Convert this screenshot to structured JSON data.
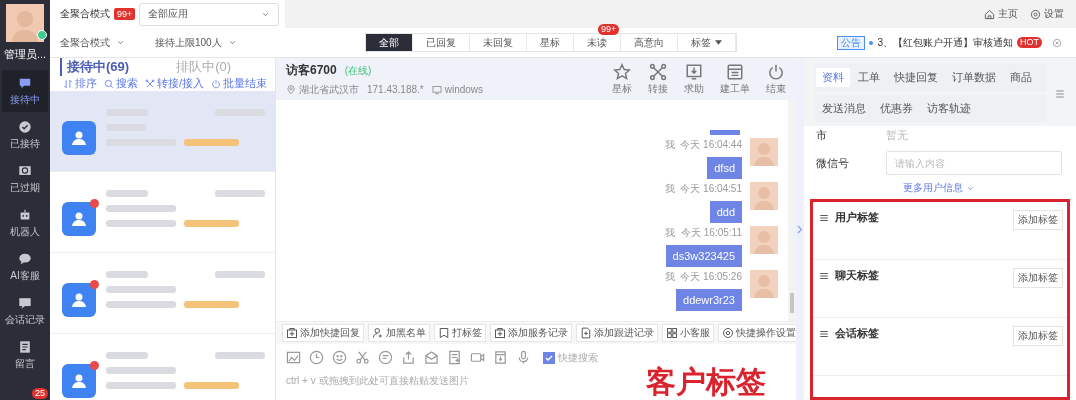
{
  "sidebar": {
    "user_name": "管理员...",
    "online": true,
    "items": [
      {
        "label": "接待中",
        "selected": true
      },
      {
        "label": "已接待",
        "selected": false
      },
      {
        "label": "已过期",
        "selected": false
      },
      {
        "label": "机器人",
        "selected": false
      },
      {
        "label": "AI客服",
        "selected": false
      },
      {
        "label": "会话记录",
        "selected": false
      },
      {
        "label": "留言",
        "selected": false
      }
    ],
    "bottom_badge": "25"
  },
  "top_bar": {
    "mode_label": "全聚合模式",
    "mode_badge": "99+",
    "app_select": "全部应用",
    "links": [
      "主页",
      "设置"
    ]
  },
  "toolbar": {
    "mode_select": "全聚合模式",
    "limit_select": "接待上限100人",
    "filters": [
      {
        "label": "全部",
        "selected": true
      },
      {
        "label": "已回复",
        "selected": false
      },
      {
        "label": "未回复",
        "selected": false
      },
      {
        "label": "星标",
        "selected": false
      },
      {
        "label": "未读",
        "selected": false,
        "badge": "99+"
      },
      {
        "label": "高意向",
        "selected": false
      },
      {
        "label": "标签",
        "selected": false,
        "dropdown": true
      }
    ]
  },
  "notice": {
    "tag": "公告",
    "text": "3、【红包账户开通】审核通知",
    "hot": "HOT"
  },
  "list_tabs": [
    {
      "label": "接待中(69)",
      "selected": true
    },
    {
      "label": "排队中(0)",
      "selected": false
    }
  ],
  "list_actions": [
    "排序",
    "搜索",
    "转接/接入",
    "批量结束"
  ],
  "conversations": [
    {
      "selected": true,
      "unread": false
    },
    {
      "selected": false,
      "unread": true
    },
    {
      "selected": false,
      "unread": true
    },
    {
      "selected": false,
      "unread": true
    }
  ],
  "chat": {
    "visitor": "访客6700",
    "status": "(在线)",
    "location": "湖北省武汉市",
    "ip": "171.43.188.*",
    "os": "windows",
    "actions": [
      "星标",
      "转接",
      "求助",
      "建工单",
      "结束"
    ],
    "messages": [
      {
        "meta": "我  今天 16:04:44",
        "text": "dfsd"
      },
      {
        "meta": "我  今天 16:04:51",
        "text": "ddd"
      },
      {
        "meta": "我  今天 16:05:11",
        "text": "ds3w323425"
      },
      {
        "meta": "我  今天 16:05:26",
        "text": "ddewr3r23"
      }
    ],
    "quick_buttons": [
      "添加快捷回复",
      "加黑名单",
      "打标签",
      "添加服务记录",
      "添加跟进记录",
      "小客服",
      "快捷操作设置"
    ],
    "quick_search": {
      "label": "快捷搜索",
      "checked": true
    },
    "input_placeholder": "ctrl + v 或拖拽到此处可直接粘贴发送图片"
  },
  "annotation": "客户标签",
  "detail": {
    "tab_rows": [
      [
        {
          "label": "资料",
          "selected": true
        },
        {
          "label": "工单",
          "selected": false
        },
        {
          "label": "快捷回复",
          "selected": false
        },
        {
          "label": "订单数据",
          "selected": false
        },
        {
          "label": "商品",
          "selected": false
        }
      ],
      [
        {
          "label": "发送消息",
          "selected": false
        },
        {
          "label": "优惠券",
          "selected": false
        },
        {
          "label": "访客轨迹",
          "selected": false
        }
      ]
    ],
    "fields": [
      {
        "kind": "text",
        "label": "市",
        "value": "暂无"
      },
      {
        "kind": "input",
        "label": "微信号",
        "placeholder": "请输入内容"
      }
    ],
    "more_link": "更多用户信息",
    "tags_highlighted": true,
    "tag_groups": [
      {
        "title": "用户标签",
        "button": "添加标签"
      },
      {
        "title": "聊天标签",
        "button": "添加标签"
      },
      {
        "title": "会话标签",
        "button": "添加标签"
      }
    ]
  }
}
